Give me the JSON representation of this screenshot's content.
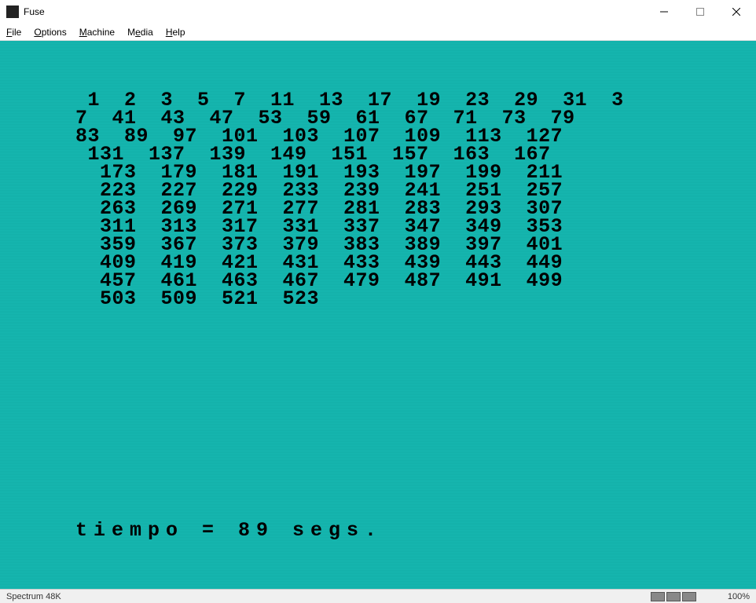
{
  "window": {
    "title": "Fuse"
  },
  "menu": {
    "file": "File",
    "options": "Options",
    "machine": "Machine",
    "media": "Media",
    "help": "Help"
  },
  "screen": {
    "lines": [
      " 1  2  3  5  7  11  13  17  19  23  29  31  3",
      "7  41  43  47  53  59  61  67  71  73  79  ",
      "83  89  97  101  103  107  109  113  127 ",
      " 131  137  139  149  151  157  163  167 ",
      "  173  179  181  191  193  197  199  211 ",
      "  223  227  229  233  239  241  251  257 ",
      "  263  269  271  277  281  283  293  307 ",
      "  311  313  317  331  337  347  349  353 ",
      "  359  367  373  379  383  389  397  401 ",
      "  409  419  421  431  433  439  443  449 ",
      "  457  461  463  467  479  487  491  499 ",
      "  503  509  521  523 "
    ],
    "timing": "tiempo = 89 segs."
  },
  "status": {
    "machine": "Spectrum 48K",
    "speed": "100%"
  }
}
